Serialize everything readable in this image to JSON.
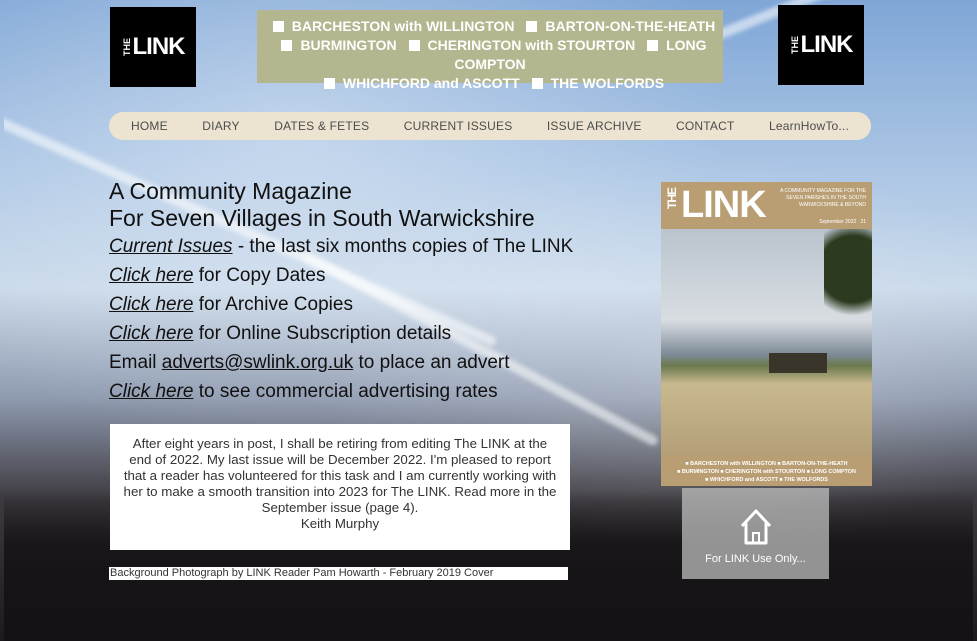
{
  "logo": {
    "the": "THE",
    "link": "LINK"
  },
  "villages": {
    "line1": [
      "BARCHESTON with WILLINGTON",
      "BARTON-ON-THE-HEATH"
    ],
    "line2": [
      "BURMINGTON",
      "CHERINGTON with STOURTON",
      "LONG COMPTON"
    ],
    "line3": [
      "WHICHFORD and ASCOTT",
      "THE WOLFORDS"
    ]
  },
  "nav": {
    "items": [
      "HOME",
      "DIARY",
      "DATES & FETES",
      "CURRENT ISSUES",
      "ISSUE ARCHIVE",
      "CONTACT",
      "LearnHowTo..."
    ]
  },
  "main": {
    "headline1": "A Community Magazine",
    "headline2": "For Seven Villages in South Warwickshire",
    "current_link": "Current Issues",
    "current_rest": " - the last six months copies of The LINK",
    "click_here": "Click here",
    "copy_dates_rest": " for Copy Dates",
    "archive_rest": " for Archive Copies",
    "subscription_rest": " for Online Subscription details",
    "email_prefix": "Email ",
    "email": "adverts@swlink.org.uk",
    "email_suffix": " to place an advert",
    "advertising_rest": " to see commercial advertising rates"
  },
  "notice": {
    "text": "After eight years in post, I shall be retiring from editing The LINK at the end of 2022. My last issue will be December 2022. I'm pleased to report that a reader has volunteered for this task and I am currently working with her to make a smooth transition into 2023 for The LINK. Read more in the September issue (page 4).",
    "signature": "Keith Murphy"
  },
  "credit": "Background Photograph by LINK Reader Pam Howarth - February 2019 Cover",
  "cover": {
    "the": "THE",
    "link": "LINK",
    "tagline": "A COMMUNITY MAGAZINE FOR THE SEVEN PARISHES IN THE SOUTH WARWICKSHIRE & BEYOND",
    "date": "September 2022",
    "number": "21",
    "footer1": "■ BARCHESTON with WILLINGTON ■ BARTON-ON-THE-HEATH",
    "footer2": "■ BURMINGTON ■ CHERINGTON with STOURTON ■ LONG COMPTON",
    "footer3": "■ WHICHFORD and ASCOTT ■ THE WOLFORDS"
  },
  "for_link": {
    "label": "For LINK Use Only...",
    "icon": "home-icon"
  },
  "colors": {
    "village_banner": "#b3b68e",
    "nav_bg": "#ece4d0",
    "cover_bg": "#b99e74"
  }
}
